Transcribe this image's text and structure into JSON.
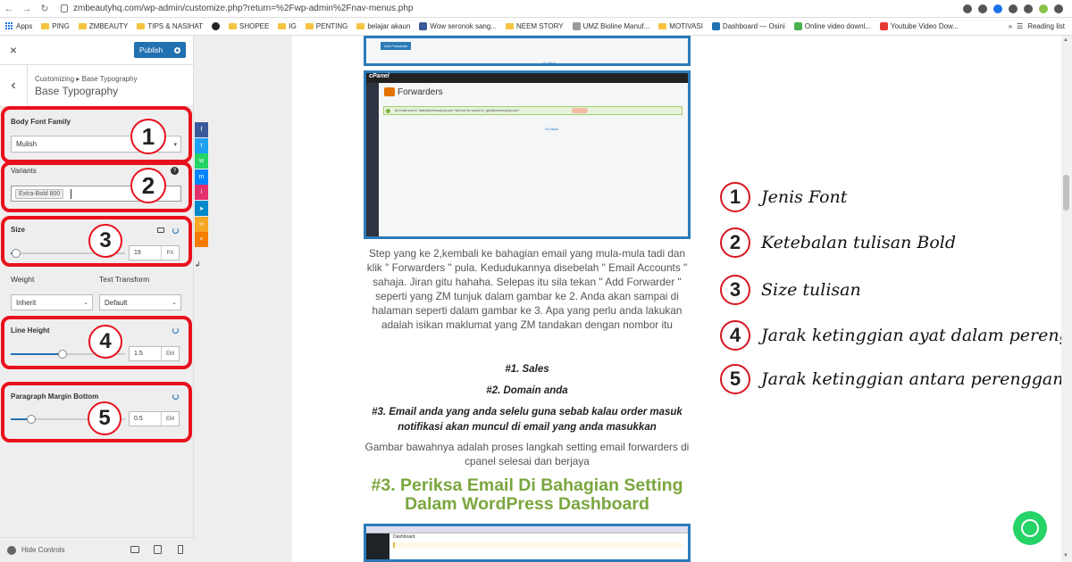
{
  "browser": {
    "url": "zmbeautyhq.com/wp-admin/customize.php?return=%2Fwp-admin%2Fnav-menus.php",
    "bookmarks": [
      "Apps",
      "PING",
      "ZMBEAUTY",
      "TIPS & NASIHAT",
      "",
      "SHOPEE",
      "IG",
      "PENTING",
      "belajar akaun",
      "Wow seronok sang...",
      "NEEM STORY",
      "UMZ Bioline Manuf...",
      "MOTIVASI",
      "Dashboard — Osini",
      "Online video downl...",
      "Youtube Video Dow..."
    ],
    "reading_list": "Reading list"
  },
  "customizer": {
    "close": "×",
    "publish": "Publish",
    "back": "‹",
    "breadcrumb": "Customizing ▸ Base Typography",
    "section_title": "Base Typography",
    "body_font_family_label": "Body Font Family",
    "body_font_value": "Mulish",
    "variants_label": "Variants",
    "variants_help": "?",
    "variants_tag": "Extra-Bold 800",
    "size_label": "Size",
    "size_value": "19",
    "size_unit": "PX",
    "size_level": 0.05,
    "weight_label": "Weight",
    "weight_value": "Inherit",
    "text_transform_label": "Text Transform",
    "text_transform_value": "Default",
    "line_height_label": "Line Height",
    "line_height_value": "1.5",
    "line_height_unit": "EM",
    "line_height_level": 0.45,
    "paragraph_margin_label": "Paragraph Margin Bottom",
    "paragraph_margin_value": "0.5",
    "paragraph_margin_unit": "EM",
    "paragraph_margin_level": 0.18,
    "hide_controls": "Hide Controls"
  },
  "callouts": [
    "1",
    "2",
    "3",
    "4",
    "5"
  ],
  "annotations": [
    {
      "num": "1",
      "text": "Jenis Font"
    },
    {
      "num": "2",
      "text": "Ketebalan tulisan Bold"
    },
    {
      "num": "3",
      "text": "Size tulisan"
    },
    {
      "num": "4",
      "text": "Jarak ketinggian ayat dalam perenggan"
    },
    {
      "num": "5",
      "text": "Jarak ketinggian antara perenggan"
    }
  ],
  "preview": {
    "top_shot_button": "Add Forwarder",
    "top_shot_link": "Go Back",
    "cpanel_logo": "cPanel",
    "forwarders_title": "Forwarders",
    "forwarders_alert": "All email sent to \"sales@zmbeautyhq.com\" will now be copied to \"gan@zmbeautyhq.com\".",
    "forwarders_link": "Go Back",
    "paragraph1": "Step yang ke 2,kembali ke bahagian email yang mula-mula tadi dan klik \" Forwarders \" pula. Kedudukannya disebelah \" Email Accounts \" sahaja. Jiran gitu hahaha. Selepas itu sila tekan \" Add Forwarder \" seperti yang ZM tunjuk dalam gambar ke 2. Anda akan sampai di halaman seperti dalam gambar ke 3. Apa yang perlu anda lakukan adalah isikan maklumat yang ZM tandakan dengan nombor itu",
    "point1": "#1. Sales",
    "point2": "#2. Domain anda",
    "point3": "#3. Email anda yang anda selelu guna sebab kalau order masuk notifikasi akan muncul di email yang anda masukkan",
    "paragraph2": "Gambar bawahnya adalah proses langkah setting email forwarders di cpanel selesai dan berjaya",
    "heading": "#3. Periksa Email Di Bahagian Setting Dalam WordPress Dashboard",
    "bottom_shot_title": "Dashboard"
  },
  "share_icons": [
    {
      "name": "facebook-icon",
      "glyph": "f",
      "color": "#3b5998"
    },
    {
      "name": "twitter-icon",
      "glyph": "t",
      "color": "#1da1f2"
    },
    {
      "name": "whatsapp-icon",
      "glyph": "w",
      "color": "#25d366"
    },
    {
      "name": "messenger-icon",
      "glyph": "m",
      "color": "#0084ff"
    },
    {
      "name": "instagram-icon",
      "glyph": "i",
      "color": "#e1306c"
    },
    {
      "name": "telegram-icon",
      "glyph": "➤",
      "color": "#0088cc"
    },
    {
      "name": "link-icon",
      "glyph": "∞",
      "color": "#f5a623"
    },
    {
      "name": "share-icon",
      "glyph": "<",
      "color": "#f57c00"
    }
  ],
  "colors": {
    "accent": "#2271b1",
    "highlight_red": "#e8101c",
    "heading_green": "#7aa63e"
  }
}
